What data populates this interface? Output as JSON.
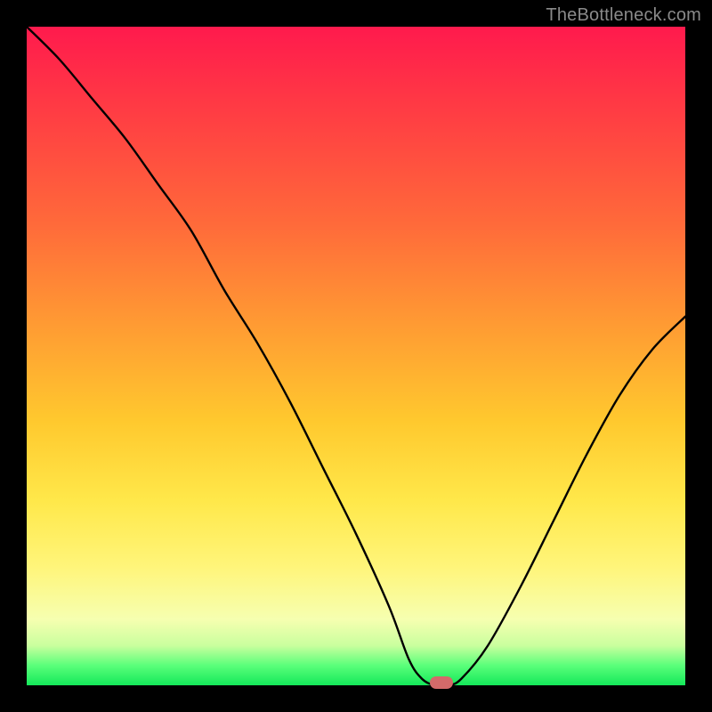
{
  "watermark": "TheBottleneck.com",
  "chart_data": {
    "type": "line",
    "title": "",
    "xlabel": "",
    "ylabel": "",
    "xlim": [
      0,
      100
    ],
    "ylim": [
      0,
      100
    ],
    "grid": false,
    "legend": false,
    "series": [
      {
        "name": "bottleneck-curve",
        "x": [
          0,
          5,
          10,
          15,
          20,
          25,
          30,
          35,
          40,
          45,
          50,
          55,
          58,
          60,
          62,
          64,
          66,
          70,
          75,
          80,
          85,
          90,
          95,
          100
        ],
        "values": [
          100,
          95,
          89,
          83,
          76,
          69,
          60,
          52,
          43,
          33,
          23,
          12,
          4,
          1,
          0,
          0,
          1,
          6,
          15,
          25,
          35,
          44,
          51,
          56
        ]
      }
    ],
    "marker": {
      "x": 63,
      "y": 0,
      "color": "#d46a6a"
    },
    "background_gradient": {
      "stops": [
        {
          "pos": 0,
          "color": "#ff1a4d"
        },
        {
          "pos": 12,
          "color": "#ff3a44"
        },
        {
          "pos": 30,
          "color": "#ff6a3a"
        },
        {
          "pos": 45,
          "color": "#ff9a33"
        },
        {
          "pos": 60,
          "color": "#ffc92e"
        },
        {
          "pos": 72,
          "color": "#ffe84a"
        },
        {
          "pos": 82,
          "color": "#fff57a"
        },
        {
          "pos": 90,
          "color": "#f6ffb0"
        },
        {
          "pos": 94,
          "color": "#c9ff9e"
        },
        {
          "pos": 97,
          "color": "#5aff7a"
        },
        {
          "pos": 100,
          "color": "#14e85a"
        }
      ]
    }
  }
}
